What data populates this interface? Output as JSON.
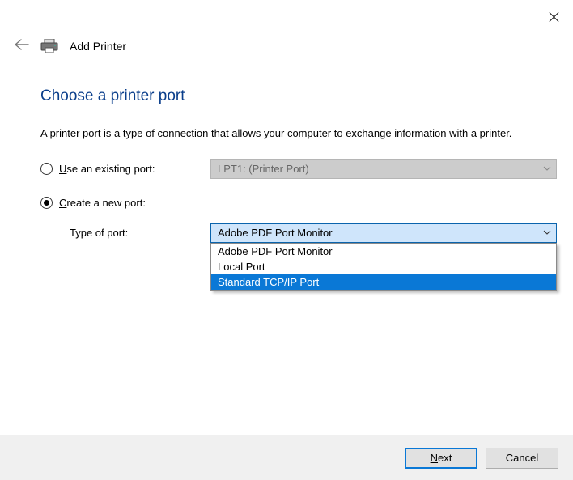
{
  "header": {
    "title": "Add Printer"
  },
  "page": {
    "heading": "Choose a printer port",
    "description": "A printer port is a type of connection that allows your computer to exchange information with a printer."
  },
  "options": {
    "existing": {
      "accel": "U",
      "rest": "se an existing port:",
      "selected": false,
      "value": "LPT1: (Printer Port)"
    },
    "create": {
      "accel": "C",
      "rest": "reate a new port:",
      "selected": true,
      "type_label": "Type of port:",
      "type_value": "Adobe PDF Port Monitor",
      "type_options": [
        {
          "label": "Adobe PDF Port Monitor",
          "highlighted": false
        },
        {
          "label": "Local Port",
          "highlighted": false
        },
        {
          "label": "Standard TCP/IP Port",
          "highlighted": true
        }
      ]
    }
  },
  "footer": {
    "next_accel": "N",
    "next_rest": "ext",
    "cancel": "Cancel"
  }
}
